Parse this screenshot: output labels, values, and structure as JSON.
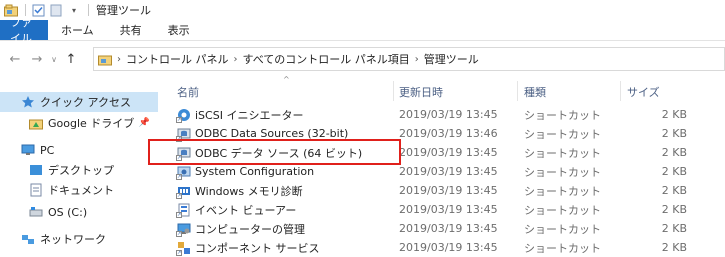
{
  "window": {
    "title": "管理ツール"
  },
  "ribbon": {
    "tabs": [
      "ファイル",
      "ホーム",
      "共有",
      "表示"
    ]
  },
  "address": {
    "crumbs": [
      "コントロール パネル",
      "すべてのコントロール パネル項目",
      "管理ツール"
    ]
  },
  "nav": {
    "quick_access": "クイック アクセス",
    "google_drive": "Google ドライブ",
    "pc": "PC",
    "desktop": "デスクトップ",
    "documents": "ドキュメント",
    "os_drive": "OS (C:)",
    "network": "ネットワーク"
  },
  "columns": {
    "name": "名前",
    "modified": "更新日時",
    "type": "種類",
    "size": "サイズ"
  },
  "files": [
    {
      "name": "iSCSI イニシエーター",
      "modified": "2019/03/19 13:45",
      "type": "ショートカット",
      "size": "2 KB",
      "icon": "iscsi-icon"
    },
    {
      "name": "ODBC Data Sources (32-bit)",
      "modified": "2019/03/19 13:46",
      "type": "ショートカット",
      "size": "2 KB",
      "icon": "odbc-icon"
    },
    {
      "name": "ODBC データ ソース (64 ビット)",
      "modified": "2019/03/19 13:45",
      "type": "ショートカット",
      "size": "2 KB",
      "icon": "odbc-icon"
    },
    {
      "name": "System Configuration",
      "modified": "2019/03/19 13:45",
      "type": "ショートカット",
      "size": "2 KB",
      "icon": "system-config-icon"
    },
    {
      "name": "Windows メモリ診断",
      "modified": "2019/03/19 13:45",
      "type": "ショートカット",
      "size": "2 KB",
      "icon": "memory-diagnostic-icon"
    },
    {
      "name": "イベント ビューアー",
      "modified": "2019/03/19 13:45",
      "type": "ショートカット",
      "size": "2 KB",
      "icon": "event-viewer-icon"
    },
    {
      "name": "コンピューターの管理",
      "modified": "2019/03/19 13:45",
      "type": "ショートカット",
      "size": "2 KB",
      "icon": "computer-management-icon"
    },
    {
      "name": "コンポーネント サービス",
      "modified": "2019/03/19 13:45",
      "type": "ショートカット",
      "size": "2 KB",
      "icon": "component-services-icon"
    }
  ],
  "colors": {
    "file_tab": "#1f6fc4",
    "selection": "#cce4f7",
    "highlight": "#e0201b"
  }
}
